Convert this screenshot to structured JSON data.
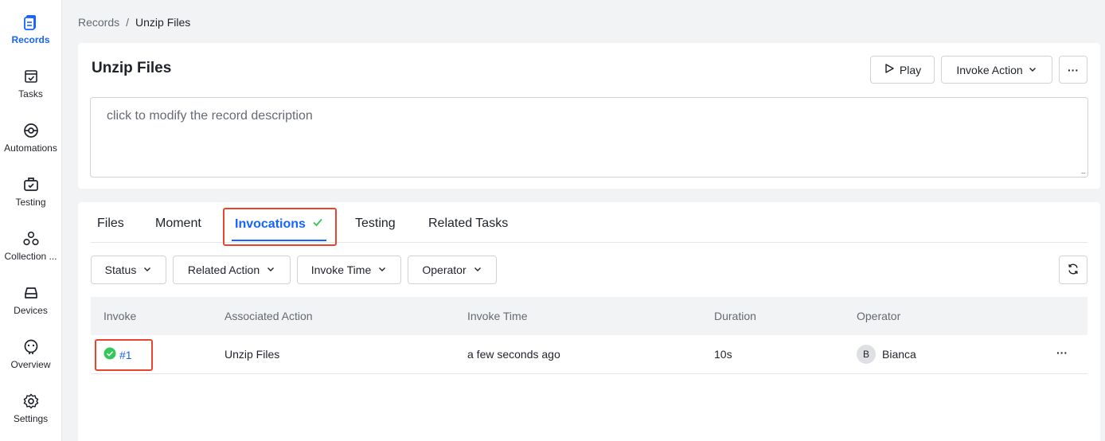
{
  "sidebar": {
    "items": [
      {
        "label": "Records",
        "icon": "records-icon",
        "active": true
      },
      {
        "label": "Tasks",
        "icon": "tasks-icon"
      },
      {
        "label": "Automations",
        "icon": "automations-icon"
      },
      {
        "label": "Testing",
        "icon": "testing-icon"
      },
      {
        "label": "Collection ...",
        "icon": "collection-icon"
      },
      {
        "label": "Devices",
        "icon": "devices-icon"
      },
      {
        "label": "Overview",
        "icon": "overview-icon"
      },
      {
        "label": "Settings",
        "icon": "settings-icon"
      }
    ]
  },
  "breadcrumb": {
    "root": "Records",
    "separator": "/",
    "current": "Unzip Files"
  },
  "header": {
    "title": "Unzip Files",
    "play_label": "Play",
    "invoke_action_label": "Invoke Action",
    "more_label": "···",
    "description": "click to modify the record description",
    "resize_grip": "..."
  },
  "tabs": [
    {
      "label": "Files"
    },
    {
      "label": "Moment"
    },
    {
      "label": "Invocations",
      "active": true
    },
    {
      "label": "Testing"
    },
    {
      "label": "Related Tasks"
    }
  ],
  "filters": {
    "status": "Status",
    "related_action": "Related Action",
    "invoke_time": "Invoke Time",
    "operator": "Operator"
  },
  "table": {
    "columns": [
      "Invoke",
      "Associated Action",
      "Invoke Time",
      "Duration",
      "Operator"
    ],
    "rows": [
      {
        "invoke": "#1",
        "action": "Unzip Files",
        "time": "a few seconds ago",
        "duration": "10s",
        "operator_initial": "B",
        "operator": "Bianca",
        "more": "···"
      }
    ]
  },
  "colors": {
    "accent": "#1664ff",
    "success": "#34c759",
    "highlight": "#e8452c"
  }
}
